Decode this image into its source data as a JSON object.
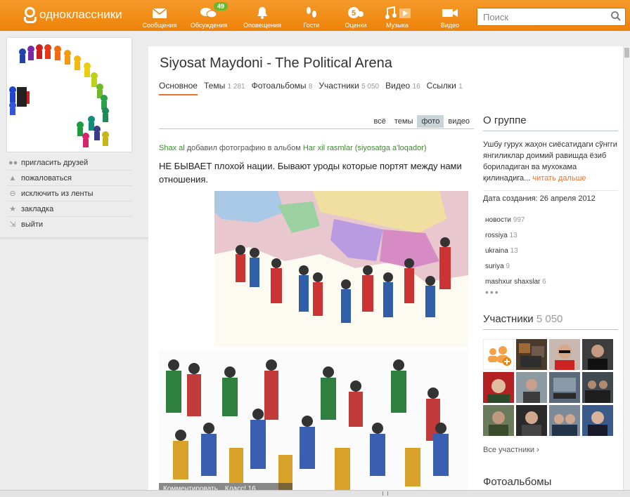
{
  "app": {
    "logo_text": "одноклассники",
    "colors": {
      "brand": "#f08a14",
      "accent": "#eb722e",
      "link_green": "#3b8d2c",
      "badge": "#6ab82f"
    }
  },
  "nav": [
    {
      "label": "Сообщения",
      "icon": "envelope-icon"
    },
    {
      "label": "Обсуждения",
      "icon": "chat-bubbles-icon",
      "badge": "49"
    },
    {
      "label": "Оповещения",
      "icon": "bell-icon"
    },
    {
      "label": "Гости",
      "icon": "footprints-icon"
    },
    {
      "label": "Оценки",
      "icon": "rating-5-icon"
    },
    {
      "label": "Музыка",
      "icon": "music-note-icon"
    },
    {
      "label": "Видео",
      "icon": "video-camera-icon"
    }
  ],
  "search": {
    "placeholder": "Поиск"
  },
  "left_menu": [
    {
      "label": "пригласить друзей",
      "icon": "people-icon"
    },
    {
      "label": "пожаловаться",
      "icon": "warning-icon"
    },
    {
      "label": "исключить из ленты",
      "icon": "no-entry-icon"
    },
    {
      "label": "закладка",
      "icon": "star-icon"
    },
    {
      "label": "выйти",
      "icon": "exit-walk-icon"
    }
  ],
  "group": {
    "title": "Siyosat Maydoni - The Political Arena",
    "tabs": [
      {
        "label": "Основное",
        "count": "",
        "active": true
      },
      {
        "label": "Темы",
        "count": "1 281"
      },
      {
        "label": "Фотоальбомы",
        "count": "8"
      },
      {
        "label": "Участники",
        "count": "5 050"
      },
      {
        "label": "Видео",
        "count": "16"
      },
      {
        "label": "Ссылки",
        "count": "1"
      }
    ]
  },
  "feed_filter": [
    "всё",
    "темы",
    "фото",
    "видео"
  ],
  "post": {
    "author": "Shax al",
    "action": "добавил фотографию в альбом",
    "album": "Har xil rasmlar (siyosatga a'loqador)",
    "text": "НЕ БЫВАЕТ плохой нации. Бывают уроды которые портят между нами отношения.",
    "bar_comments": "Комментировать",
    "bar_class": "Класс! 16"
  },
  "about": {
    "heading": "О группе",
    "text": "Ушбу гурух жаҳон сиёсатидаги сўнгги янгиликлар доимий равишда ёзиб бориладиган ва мухокама қилинадига...",
    "read_more": "читать дальше",
    "created": "Дата создания: 26 апреля 2012"
  },
  "tags": [
    {
      "name": "новости",
      "count": "997"
    },
    {
      "name": "rossiya",
      "count": "13"
    },
    {
      "name": "ukraina",
      "count": "13"
    },
    {
      "name": "suriya",
      "count": "9"
    },
    {
      "name": "mashxur shaxslar",
      "count": "6"
    }
  ],
  "members": {
    "heading": "Участники",
    "count": "5 050",
    "all_link": "Все участники ›"
  },
  "albums": {
    "heading": "Фотоальбомы"
  }
}
